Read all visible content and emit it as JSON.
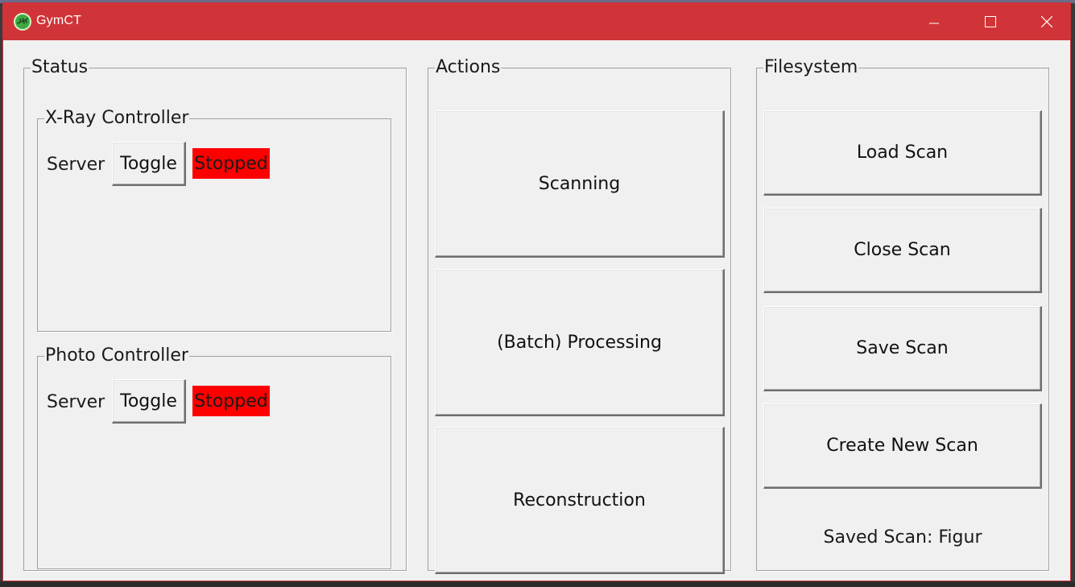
{
  "window": {
    "title": "GymCT",
    "icon": "gymct-lizard-icon",
    "controls": [
      "minimize-icon",
      "maximize-icon",
      "close-icon"
    ]
  },
  "status": {
    "label": "Status",
    "xray": {
      "label": "X-Ray Controller",
      "server_label": "Server",
      "toggle_label": "Toggle",
      "state": "Stopped",
      "state_color": "#ff0000"
    },
    "photo": {
      "label": "Photo Controller",
      "server_label": "Server",
      "toggle_label": "Toggle",
      "state": "Stopped",
      "state_color": "#ff0000"
    }
  },
  "actions": {
    "label": "Actions",
    "buttons": [
      "Scanning",
      "(Batch) Processing",
      "Reconstruction"
    ]
  },
  "filesystem": {
    "label": "Filesystem",
    "buttons": [
      "Load Scan",
      "Close Scan",
      "Save Scan",
      "Create New Scan"
    ],
    "saved_scan": "Saved Scan: Figur"
  },
  "colors": {
    "titlebar": "#d13438",
    "window_bg": "#f0f0f0",
    "stopped": "#ff0000"
  }
}
